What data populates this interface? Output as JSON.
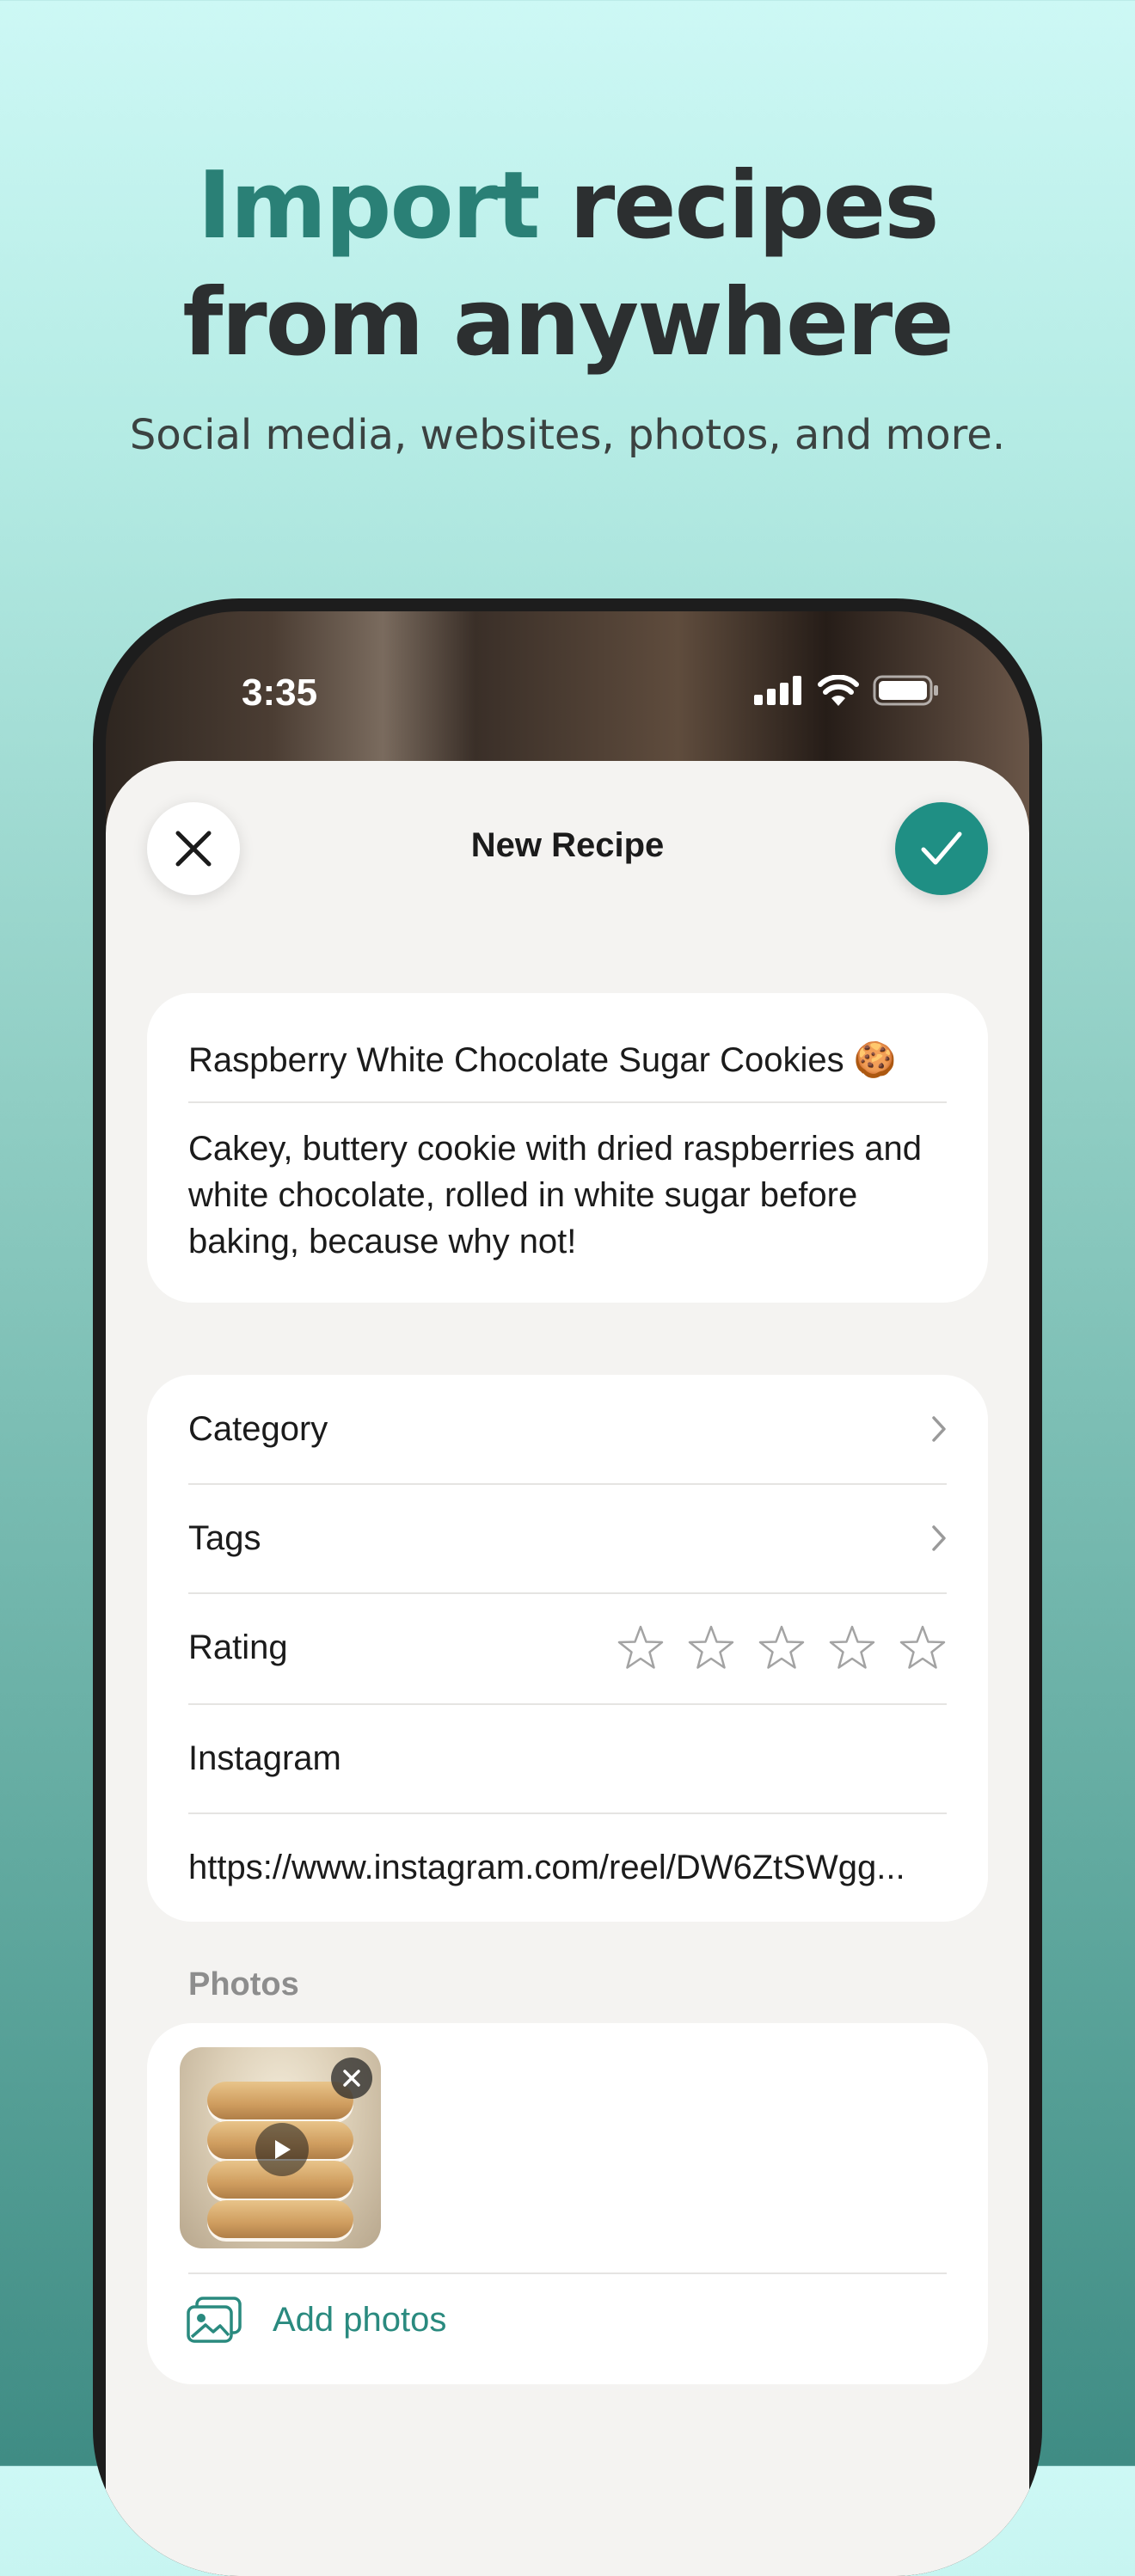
{
  "hero": {
    "title_accent": "Import",
    "title_rest_line1": " recipes",
    "title_line2": "from anywhere",
    "subtitle": "Social media, websites, photos, and more."
  },
  "status_bar": {
    "time": "3:35"
  },
  "nav": {
    "title": "New Recipe"
  },
  "recipe": {
    "title": "Raspberry White Chocolate Sugar Cookies 🍪",
    "description": "Cakey, buttery cookie with dried raspberries and white chocolate, rolled in white sugar before baking, because why not!"
  },
  "meta": {
    "category_label": "Category",
    "tags_label": "Tags",
    "rating_label": "Rating",
    "rating_value": 0,
    "rating_max": 5,
    "source_label": "Instagram",
    "source_url": "https://www.instagram.com/reel/DW6ZtSWgg..."
  },
  "photos": {
    "section_label": "Photos",
    "add_label": "Add photos"
  },
  "colors": {
    "accent": "#2a8076",
    "done_button": "#1f8f84",
    "link": "#2a8a7f"
  }
}
